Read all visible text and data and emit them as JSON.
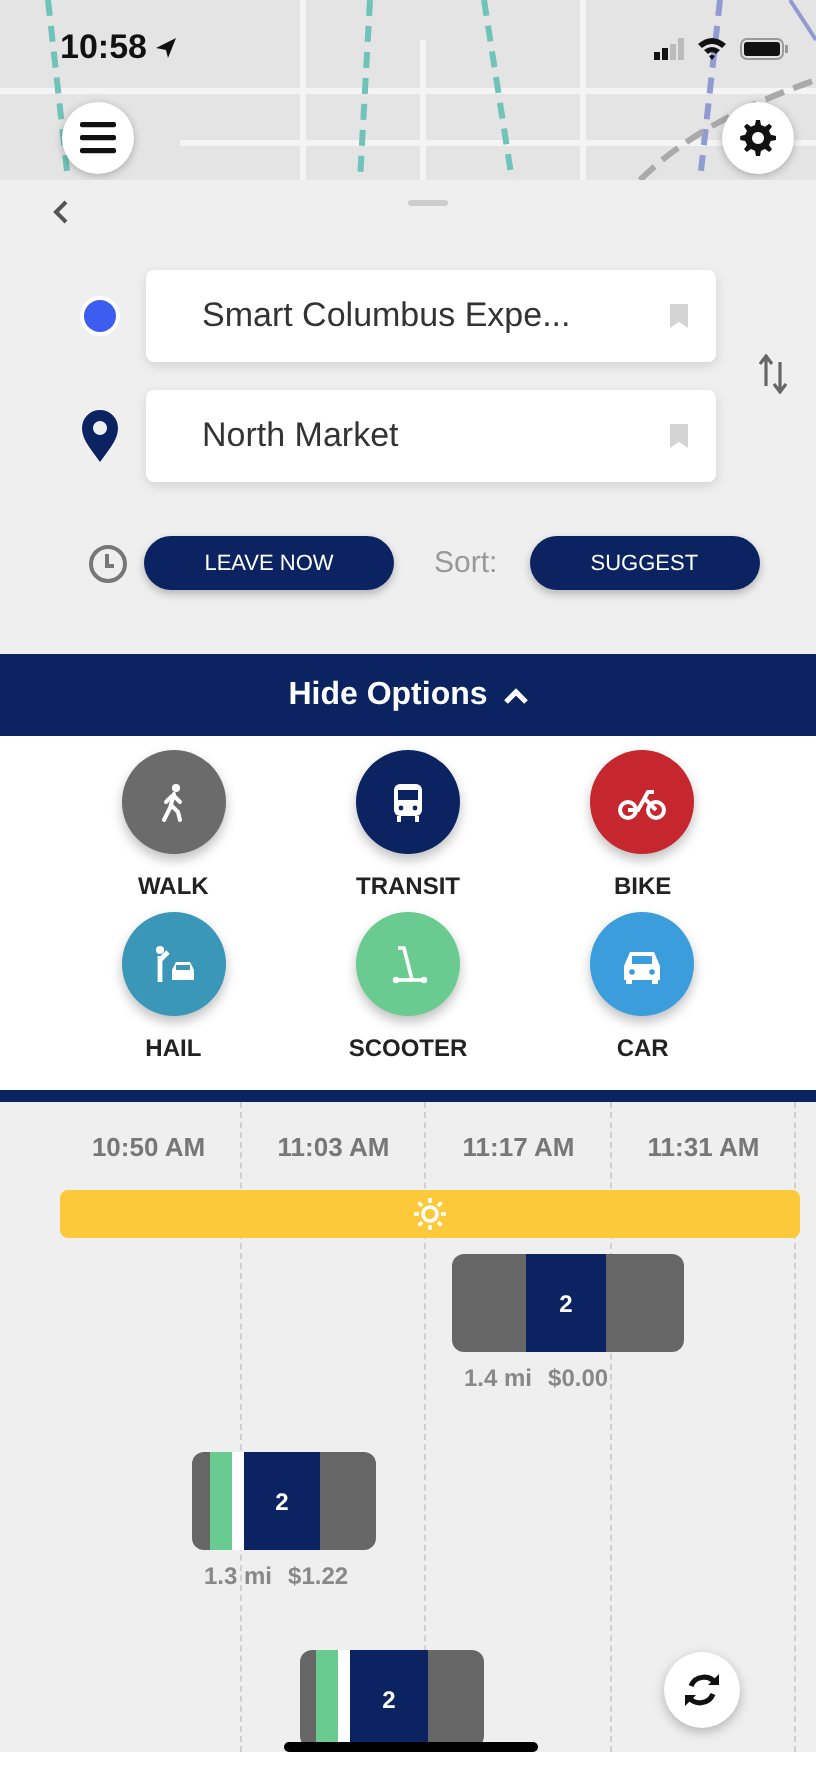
{
  "status_bar": {
    "time": "10:58"
  },
  "origin": {
    "value": "Smart Columbus Expe..."
  },
  "destination": {
    "value": "North Market"
  },
  "leave_button": "LEAVE NOW",
  "sort_label": "Sort:",
  "sort_button": "SUGGEST",
  "options_toggle": {
    "label": "Hide Options",
    "expanded": true
  },
  "modes": [
    {
      "kind": "walk",
      "label": "WALK",
      "color": "#6b6b6b"
    },
    {
      "kind": "transit",
      "label": "TRANSIT",
      "color": "#0b2461"
    },
    {
      "kind": "bike",
      "label": "BIKE",
      "color": "#c6262e"
    },
    {
      "kind": "hail",
      "label": "HAIL",
      "color": "#3a97b8"
    },
    {
      "kind": "scooter",
      "label": "SCOOTER",
      "color": "#6acb91"
    },
    {
      "kind": "car",
      "label": "CAR",
      "color": "#3b9ddb"
    }
  ],
  "timeline": {
    "times": [
      "10:50 AM",
      "11:03 AM",
      "11:17 AM",
      "11:31 AM"
    ],
    "trips": [
      {
        "segments": [
          {
            "kind": "walk"
          },
          {
            "kind": "transit",
            "label": "2"
          },
          {
            "kind": "walk"
          }
        ],
        "distance": "1.4 mi",
        "cost": "$0.00"
      },
      {
        "segments": [
          {
            "kind": "walk"
          },
          {
            "kind": "scooter"
          },
          {
            "kind": "gap"
          },
          {
            "kind": "transit",
            "label": "2"
          },
          {
            "kind": "walk"
          }
        ],
        "distance": "1.3 mi",
        "cost": "$1.22"
      },
      {
        "segments": [
          {
            "kind": "walk"
          },
          {
            "kind": "scooter"
          },
          {
            "kind": "gap"
          },
          {
            "kind": "transit",
            "label": "2"
          },
          {
            "kind": "walk"
          }
        ]
      }
    ]
  }
}
